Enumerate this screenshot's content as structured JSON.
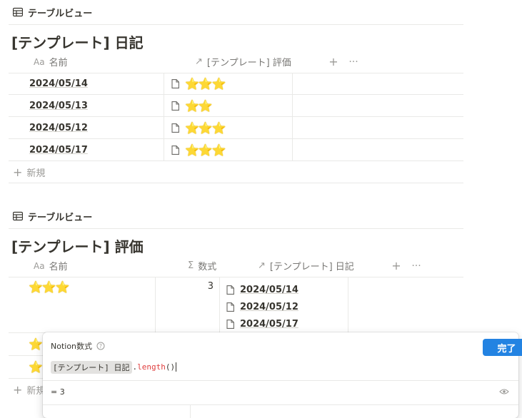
{
  "table1": {
    "view_label": "テーブルビュー",
    "title": "[テンプレート] 日記",
    "columns": {
      "name": "名前",
      "relation": "[テンプレート] 評価"
    },
    "rows": [
      {
        "name": "2024/05/14",
        "rating": "⭐⭐⭐"
      },
      {
        "name": "2024/05/13",
        "rating": "⭐⭐"
      },
      {
        "name": "2024/05/12",
        "rating": "⭐⭐⭐"
      },
      {
        "name": "2024/05/17",
        "rating": "⭐⭐⭐"
      }
    ],
    "new_label": "新規"
  },
  "table2": {
    "view_label": "テーブルビュー",
    "title": "[テンプレート] 評価",
    "columns": {
      "name": "名前",
      "formula": "数式",
      "relation": "[テンプレート] 日記"
    },
    "row1": {
      "name": "⭐⭐⭐",
      "formula": "3",
      "relations": [
        "2024/05/14",
        "2024/05/12",
        "2024/05/17"
      ]
    },
    "row2": {
      "name": "⭐"
    },
    "row3": {
      "name": "⭐"
    },
    "new_label": "新規"
  },
  "formula_editor": {
    "title": "Notion数式",
    "done_label": "完了",
    "token": "[テンプレート] 日記",
    "dot": ".",
    "method": "length",
    "parens": "()",
    "result": "= 3"
  },
  "colors": {
    "accent": "#2383e2",
    "method": "#e03e3e",
    "star": "#f5c518"
  },
  "icons": [
    "table-icon",
    "text-type-icon",
    "relation-arrow-icon",
    "plus-icon",
    "more-icon",
    "document-icon",
    "sigma-icon",
    "help-icon",
    "eye-icon"
  ]
}
